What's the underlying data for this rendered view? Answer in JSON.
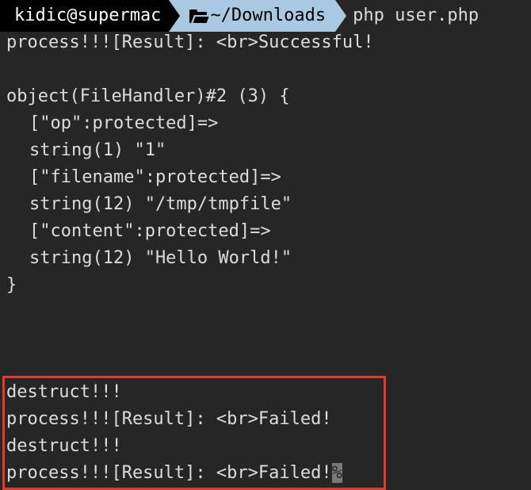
{
  "prompt": {
    "user_host": "kidic@supermac",
    "directory": "~/Downloads",
    "command": "php user.php",
    "folder_icon": "folder-open-icon"
  },
  "output": {
    "line1": "process!!![Result]: <br>Successful!",
    "obj_header": "object(FileHandler)#2 (3) {",
    "op_key": "[\"op\":protected]=>",
    "op_val": "string(1) \"1\"",
    "filename_key": "[\"filename\":protected]=>",
    "filename_val": "string(12) \"/tmp/tmpfile\"",
    "content_key": "[\"content\":protected]=>",
    "content_val": "string(12) \"Hello World!\"",
    "obj_close": "}",
    "destruct1": "destruct!!!",
    "failed1": "process!!![Result]: <br>Failed!",
    "destruct2": "destruct!!!",
    "failed2": "process!!![Result]: <br>Failed!",
    "cursor": "%"
  },
  "colors": {
    "background": "#262626",
    "text": "#dcdcdc",
    "prompt_user_bg": "#000000",
    "prompt_dir_bg": "#a9c8e2",
    "highlight_border": "#e03c2a"
  }
}
